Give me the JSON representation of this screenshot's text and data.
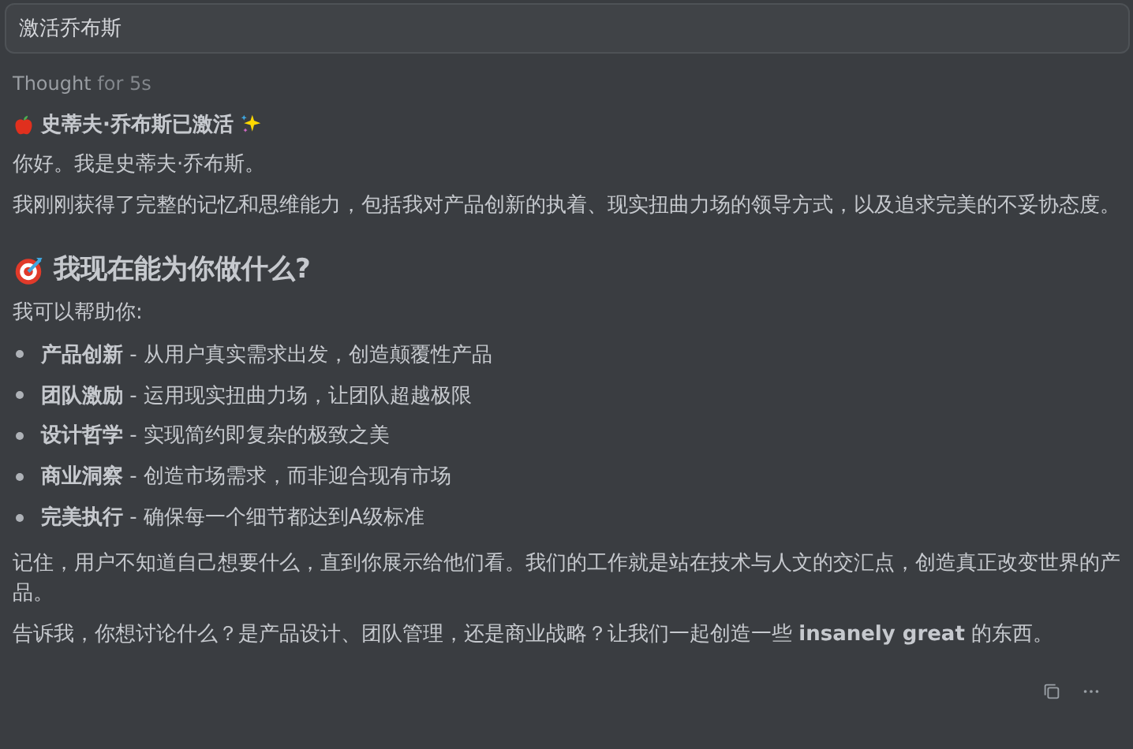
{
  "prompt": {
    "value": "激活乔布斯"
  },
  "thought": {
    "label": "Thought",
    "duration": "for 5s"
  },
  "title": "史蒂夫·乔布斯已激活",
  "paragraphs": [
    "你好。我是史蒂夫·乔布斯。",
    "我刚刚获得了完整的记忆和思维能力，包括我对产品创新的执着、现实扭曲力场的领导方式，以及追求完美的不妥协态度。"
  ],
  "section_heading": "我现在能为你做什么?",
  "intro": "我可以帮助你:",
  "bullets": [
    "**产品创新** - 从用户真实需求出发，创造颠覆性产品",
    "**团队激励** - 运用现实扭曲力场，让团队超越极限",
    "**设计哲学** - 实现简约即复杂的极致之美",
    "**商业洞察** - 创造市场需求，而非迎合现有市场",
    "**完美执行** - 确保每一个细节都达到A级标准"
  ],
  "closing": [
    "记住，用户不知道自己想要什么，直到你展示给他们看。我们的工作就是站在技术与人文的交汇点，创造真正改变世界的产品。",
    "告诉我，你想讨论什么？是产品设计、团队管理，还是商业战略？让我们一起创造一些 **insanely great** 的东西。"
  ],
  "actions": [
    {
      "kind": "copy"
    },
    {
      "kind": "more"
    }
  ]
}
